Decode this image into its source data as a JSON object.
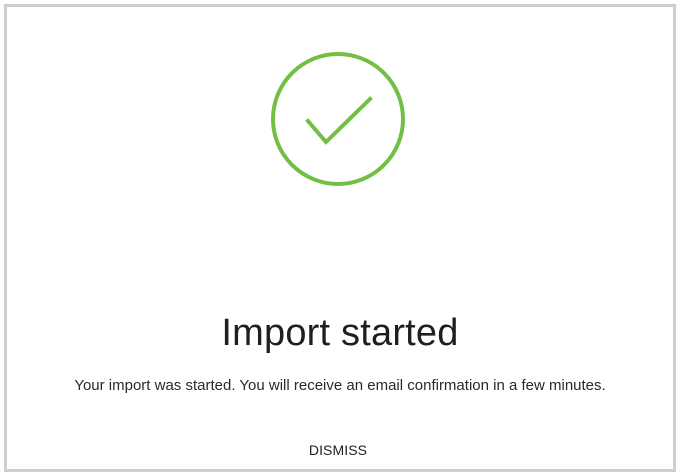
{
  "dialog": {
    "icon": "check-circle-icon",
    "title": "Import started",
    "message": "Your import was started. You will receive an email confirmation in a few minutes.",
    "dismiss_label": "DISMISS"
  },
  "colors": {
    "success": "#72bf44",
    "border": "#cfcfcf"
  }
}
